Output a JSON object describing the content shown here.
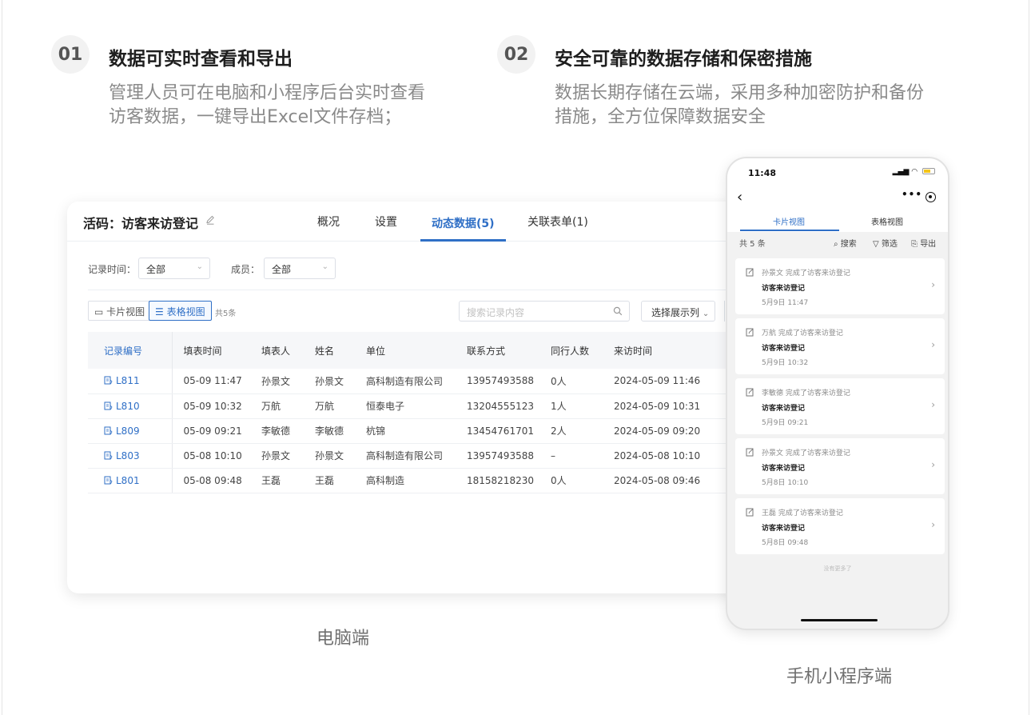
{
  "features": [
    {
      "num": "01",
      "title": "数据可实时查看和导出",
      "desc": [
        "管理人员可在电脑和小程序后台实时查看",
        "访客数据，一键导出Excel文件存档；"
      ]
    },
    {
      "num": "02",
      "title": "安全可靠的数据存储和保密措施",
      "desc": [
        "数据长期存储在云端，采用多种加密防护和备份",
        "措施，全方位保障数据安全"
      ]
    }
  ],
  "desktop": {
    "title": "活码：访客来访登记",
    "tabs": [
      "概况",
      "设置",
      "动态数据(5)",
      "关联表单(1)"
    ],
    "active_tab": "动态数据(5)",
    "filters": {
      "time_label": "记录时间：",
      "time_value": "全部",
      "member_label": "成员：",
      "member_value": "全部"
    },
    "views": {
      "card": "卡片视图",
      "table": "表格视图"
    },
    "count": "共5条",
    "search_placeholder": "搜索记录内容",
    "select_columns": "选择展示列",
    "table": {
      "headers": [
        "记录编号",
        "填表时间",
        "填表人",
        "姓名",
        "单位",
        "联系方式",
        "同行人数",
        "来访时间"
      ],
      "rows": [
        [
          "L811",
          "05-09 11:47",
          "孙景文",
          "孙景文",
          "高科制造有限公司",
          "13957493588",
          "0人",
          "2024-05-09 11:46"
        ],
        [
          "L810",
          "05-09 10:32",
          "万航",
          "万航",
          "恒泰电子",
          "13204555123",
          "1人",
          "2024-05-09 10:31"
        ],
        [
          "L809",
          "05-09 09:21",
          "李敏德",
          "李敏德",
          "杭锦",
          "13454761701",
          "2人",
          "2024-05-09 09:20"
        ],
        [
          "L803",
          "05-08 10:10",
          "孙景文",
          "孙景文",
          "高科制造有限公司",
          "13957493588",
          "–",
          "2024-05-08 10:10"
        ],
        [
          "L801",
          "05-08 09:48",
          "王磊",
          "王磊",
          "高科制造",
          "18158218230",
          "0人",
          "2024-05-08 09:46"
        ]
      ]
    },
    "caption": "电脑端"
  },
  "phone": {
    "time": "11:48",
    "tabs": [
      "卡片视图",
      "表格视图"
    ],
    "count": "共 5 条",
    "tools": {
      "search": "搜索",
      "filter": "筛选",
      "export": "导出"
    },
    "cards": [
      {
        "who": "孙景文 完成了访客来访登记",
        "title": "访客来访登记",
        "time": "5月9日 11:47"
      },
      {
        "who": "万航 完成了访客来访登记",
        "title": "访客来访登记",
        "time": "5月9日 10:32"
      },
      {
        "who": "李敏德 完成了访客来访登记",
        "title": "访客来访登记",
        "time": "5月9日 09:21"
      },
      {
        "who": "孙景文 完成了访客来访登记",
        "title": "访客来访登记",
        "time": "5月8日 10:10"
      },
      {
        "who": "王磊 完成了访客来访登记",
        "title": "访客来访登记",
        "time": "5月8日 09:48"
      }
    ],
    "no_more": "没有更多了",
    "caption": "手机小程序端"
  },
  "colors": {
    "accent": "#2f6fc6",
    "muted_text": "#8a8a8a"
  }
}
